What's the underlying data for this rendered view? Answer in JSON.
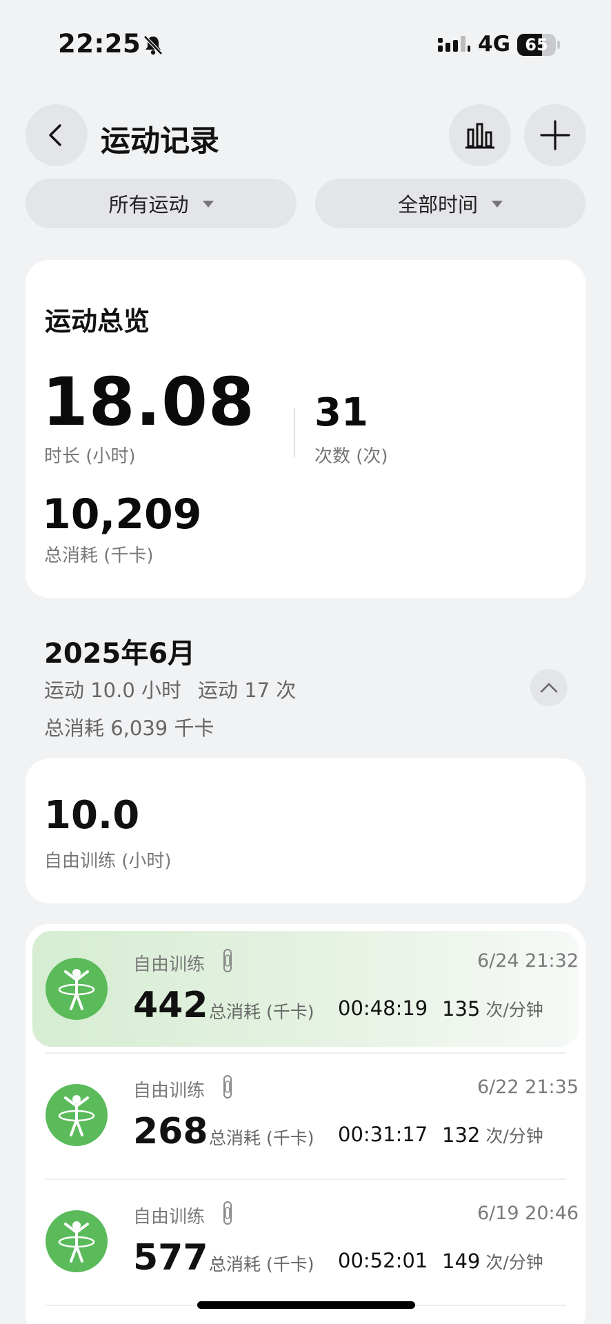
{
  "status_bar": {
    "time": "22:25",
    "network": "4G",
    "battery": "65",
    "battery_level": 0.65
  },
  "header": {
    "title": "运动记录"
  },
  "filters": {
    "sport": "所有运动",
    "time": "全部时间"
  },
  "overview": {
    "title": "运动总览",
    "duration_value": "18.08",
    "duration_label": "时长 (小时)",
    "count_value": "31",
    "count_label": "次数 (次)",
    "kcal_value": "10,209",
    "kcal_label": "总消耗 (千卡)"
  },
  "month": {
    "title": "2025年6月",
    "hours_text": "运动 10.0 小时",
    "count_text": "运动 17 次",
    "kcal_text": "总消耗 6,039 千卡"
  },
  "summary": {
    "value": "10.0",
    "label": "自由训练 (小时)"
  },
  "records": [
    {
      "type": "自由训练",
      "date": "6/24 21:32",
      "kcal": "442",
      "kcal_label": "总消耗 (千卡)",
      "duration": "00:48:19",
      "rate": "135",
      "rate_unit": "次/分钟"
    },
    {
      "type": "自由训练",
      "date": "6/22 21:35",
      "kcal": "268",
      "kcal_label": "总消耗 (千卡)",
      "duration": "00:31:17",
      "rate": "132",
      "rate_unit": "次/分钟"
    },
    {
      "type": "自由训练",
      "date": "6/19 20:46",
      "kcal": "577",
      "kcal_label": "总消耗 (千卡)",
      "duration": "00:52:01",
      "rate": "149",
      "rate_unit": "次/分钟"
    }
  ],
  "icons": {
    "back": "back-arrow-icon",
    "stats": "bar-chart-icon",
    "add": "plus-icon",
    "mute": "bell-slash-icon",
    "signal": "cellular-signal-icon",
    "collapse": "chevron-up-icon",
    "sport": "hula-hoop-person-icon",
    "device": "watch-icon"
  },
  "colors": {
    "accent_green": "#5bbb5b",
    "background": "#f1f2f4",
    "card": "#ffffff"
  }
}
